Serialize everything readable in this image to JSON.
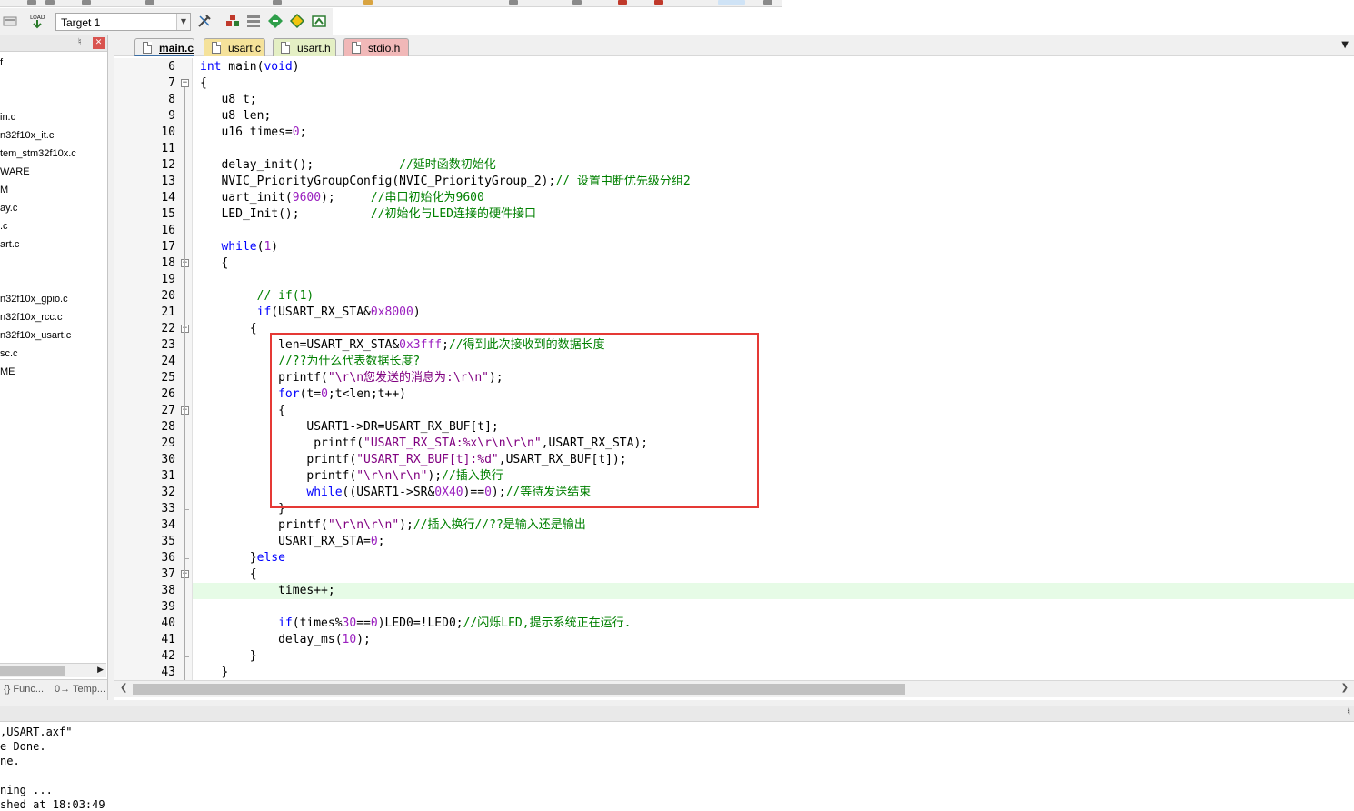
{
  "toolbar": {
    "target_label": "Target 1",
    "load_label": "Load"
  },
  "project_panel": {
    "items": [
      {
        "label": "f"
      },
      {
        "label": "in.c"
      },
      {
        "label": "n32f10x_it.c"
      },
      {
        "label": "tem_stm32f10x.c"
      },
      {
        "label": "WARE"
      },
      {
        "label": "M"
      },
      {
        "label": "ay.c"
      },
      {
        "label": ".c"
      },
      {
        "label": "art.c"
      },
      {
        "label": "n32f10x_gpio.c"
      },
      {
        "label": "n32f10x_rcc.c"
      },
      {
        "label": "n32f10x_usart.c"
      },
      {
        "label": "sc.c"
      },
      {
        "label": "ME"
      }
    ],
    "bottom_tabs": [
      {
        "label": "{} Func..."
      },
      {
        "label": "0→ Temp..."
      }
    ]
  },
  "editor_tabs": [
    {
      "label": "main.c",
      "active": true,
      "color": "#f0f0f0"
    },
    {
      "label": "usart.c",
      "active": false,
      "color": "#f5e29a"
    },
    {
      "label": "usart.h",
      "active": false,
      "color": "#e4efc4"
    },
    {
      "label": "stdio.h",
      "active": false,
      "color": "#f1b8b8"
    }
  ],
  "code": {
    "line_numbers": [
      "6",
      "7",
      "8",
      "9",
      "10",
      "11",
      "12",
      "13",
      "14",
      "15",
      "16",
      "17",
      "18",
      "19",
      "20",
      "21",
      "22",
      "23",
      "24",
      "25",
      "26",
      "27",
      "28",
      "29",
      "30",
      "31",
      "32",
      "33",
      "34",
      "35",
      "36",
      "37",
      "38",
      "39",
      "40",
      "41",
      "42",
      "43"
    ],
    "highlighted_line": "38",
    "lines": [
      {
        "indent": "",
        "segments": [
          {
            "t": "kw",
            "v": "int"
          },
          {
            "t": "",
            "v": " main("
          },
          {
            "t": "kw",
            "v": "void"
          },
          {
            "t": "",
            "v": ")"
          }
        ]
      },
      {
        "indent": "",
        "segments": [
          {
            "t": "",
            "v": "{"
          }
        ]
      },
      {
        "indent": "   ",
        "segments": [
          {
            "t": "",
            "v": "u8 t;"
          }
        ]
      },
      {
        "indent": "   ",
        "segments": [
          {
            "t": "",
            "v": "u8 len;"
          }
        ]
      },
      {
        "indent": "   ",
        "segments": [
          {
            "t": "",
            "v": "u16 times="
          },
          {
            "t": "num",
            "v": "0"
          },
          {
            "t": "",
            "v": ";"
          }
        ]
      },
      {
        "indent": "",
        "segments": []
      },
      {
        "indent": "   ",
        "segments": [
          {
            "t": "",
            "v": "delay_init();"
          },
          {
            "t": "",
            "v": "            "
          },
          {
            "t": "cm",
            "v": "//延时函数初始化"
          }
        ]
      },
      {
        "indent": "   ",
        "segments": [
          {
            "t": "",
            "v": "NVIC_PriorityGroupConfig(NVIC_PriorityGroup_2);"
          },
          {
            "t": "cm",
            "v": "// 设置中断优先级分组2"
          }
        ]
      },
      {
        "indent": "   ",
        "segments": [
          {
            "t": "",
            "v": "uart_init("
          },
          {
            "t": "num",
            "v": "9600"
          },
          {
            "t": "",
            "v": ");     "
          },
          {
            "t": "cm",
            "v": "//串口初始化为9600"
          }
        ]
      },
      {
        "indent": "   ",
        "segments": [
          {
            "t": "",
            "v": "LED_Init();          "
          },
          {
            "t": "cm",
            "v": "//初始化与LED连接的硬件接口"
          }
        ]
      },
      {
        "indent": "",
        "segments": []
      },
      {
        "indent": "   ",
        "segments": [
          {
            "t": "kw",
            "v": "while"
          },
          {
            "t": "",
            "v": "("
          },
          {
            "t": "num",
            "v": "1"
          },
          {
            "t": "",
            "v": ")"
          }
        ]
      },
      {
        "indent": "   ",
        "segments": [
          {
            "t": "",
            "v": "{"
          }
        ]
      },
      {
        "indent": "",
        "segments": []
      },
      {
        "indent": "        ",
        "segments": [
          {
            "t": "cm",
            "v": "// if(1)"
          }
        ]
      },
      {
        "indent": "        ",
        "segments": [
          {
            "t": "kw",
            "v": "if"
          },
          {
            "t": "",
            "v": "(USART_RX_STA&"
          },
          {
            "t": "num",
            "v": "0x8000"
          },
          {
            "t": "",
            "v": ")"
          }
        ]
      },
      {
        "indent": "       ",
        "segments": [
          {
            "t": "",
            "v": "{"
          }
        ]
      },
      {
        "indent": "           ",
        "segments": [
          {
            "t": "",
            "v": "len=USART_RX_STA&"
          },
          {
            "t": "num",
            "v": "0x3fff"
          },
          {
            "t": "",
            "v": ";"
          },
          {
            "t": "cm",
            "v": "//得到此次接收到的数据长度"
          }
        ]
      },
      {
        "indent": "           ",
        "segments": [
          {
            "t": "cm",
            "v": "//??为什么代表数据长度?"
          }
        ]
      },
      {
        "indent": "           ",
        "segments": [
          {
            "t": "",
            "v": "printf("
          },
          {
            "t": "str",
            "v": "\"\\r\\n您发送的消息为:\\r\\n\""
          },
          {
            "t": "",
            "v": ");"
          }
        ]
      },
      {
        "indent": "           ",
        "segments": [
          {
            "t": "kw",
            "v": "for"
          },
          {
            "t": "",
            "v": "(t="
          },
          {
            "t": "num",
            "v": "0"
          },
          {
            "t": "",
            "v": ";t<len;t++)"
          }
        ]
      },
      {
        "indent": "           ",
        "segments": [
          {
            "t": "",
            "v": "{"
          }
        ]
      },
      {
        "indent": "               ",
        "segments": [
          {
            "t": "",
            "v": "USART1->DR=USART_RX_BUF[t];"
          }
        ]
      },
      {
        "indent": "                ",
        "segments": [
          {
            "t": "",
            "v": "printf("
          },
          {
            "t": "str",
            "v": "\"USART_RX_STA:%x\\r\\n\\r\\n\""
          },
          {
            "t": "",
            "v": ",USART_RX_STA);"
          }
        ]
      },
      {
        "indent": "               ",
        "segments": [
          {
            "t": "",
            "v": "printf("
          },
          {
            "t": "str",
            "v": "\"USART_RX_BUF[t]:%d\""
          },
          {
            "t": "",
            "v": ",USART_RX_BUF[t]);"
          }
        ]
      },
      {
        "indent": "               ",
        "segments": [
          {
            "t": "",
            "v": "printf("
          },
          {
            "t": "str",
            "v": "\"\\r\\n\\r\\n\""
          },
          {
            "t": "",
            "v": ");"
          },
          {
            "t": "cm",
            "v": "//插入换行"
          }
        ]
      },
      {
        "indent": "               ",
        "segments": [
          {
            "t": "kw",
            "v": "while"
          },
          {
            "t": "",
            "v": "((USART1->SR&"
          },
          {
            "t": "num",
            "v": "0X40"
          },
          {
            "t": "",
            "v": ")=="
          },
          {
            "t": "num",
            "v": "0"
          },
          {
            "t": "",
            "v": ");"
          },
          {
            "t": "cm",
            "v": "//等待发送结束"
          }
        ]
      },
      {
        "indent": "           ",
        "segments": [
          {
            "t": "",
            "v": "}"
          }
        ]
      },
      {
        "indent": "           ",
        "segments": [
          {
            "t": "",
            "v": "printf("
          },
          {
            "t": "str",
            "v": "\"\\r\\n\\r\\n\""
          },
          {
            "t": "",
            "v": ");"
          },
          {
            "t": "cm",
            "v": "//插入换行//??是输入还是输出"
          }
        ]
      },
      {
        "indent": "           ",
        "segments": [
          {
            "t": "",
            "v": "USART_RX_STA="
          },
          {
            "t": "num",
            "v": "0"
          },
          {
            "t": "",
            "v": ";"
          }
        ]
      },
      {
        "indent": "       ",
        "segments": [
          {
            "t": "",
            "v": "}"
          },
          {
            "t": "kw",
            "v": "else"
          }
        ]
      },
      {
        "indent": "       ",
        "segments": [
          {
            "t": "",
            "v": "{"
          }
        ]
      },
      {
        "indent": "           ",
        "segments": [
          {
            "t": "",
            "v": "times++;"
          }
        ]
      },
      {
        "indent": "",
        "segments": []
      },
      {
        "indent": "           ",
        "segments": [
          {
            "t": "kw",
            "v": "if"
          },
          {
            "t": "",
            "v": "(times%"
          },
          {
            "t": "num",
            "v": "30"
          },
          {
            "t": "",
            "v": "=="
          },
          {
            "t": "num",
            "v": "0"
          },
          {
            "t": "",
            "v": ")LED0=!LED0;"
          },
          {
            "t": "cm",
            "v": "//闪烁LED,提示系统正在运行."
          }
        ]
      },
      {
        "indent": "           ",
        "segments": [
          {
            "t": "",
            "v": "delay_ms("
          },
          {
            "t": "num",
            "v": "10"
          },
          {
            "t": "",
            "v": ");"
          }
        ]
      },
      {
        "indent": "       ",
        "segments": [
          {
            "t": "",
            "v": "}"
          }
        ]
      },
      {
        "indent": "   ",
        "segments": [
          {
            "t": "",
            "v": "}"
          }
        ]
      }
    ]
  },
  "build_output": {
    "lines": [
      ",USART.axf\"",
      "e Done.",
      "ne.",
      "",
      "ning ...",
      "shed at 18:03:49"
    ]
  },
  "colors": {
    "keyword": "#0000ff",
    "number": "#9a1fbf",
    "string": "#800080",
    "comment": "#008000",
    "highlight_line": "#e6fbe6",
    "annotation_box": "#e53935"
  }
}
